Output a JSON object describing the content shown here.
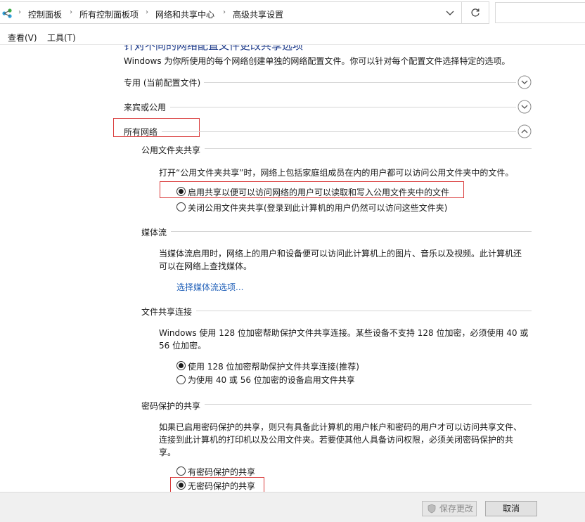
{
  "address_bar": {
    "crumbs": [
      "控制面板",
      "所有控制面板项",
      "网络和共享中心",
      "高级共享设置"
    ],
    "search_placeholder": ""
  },
  "menu": {
    "view": "查看(V)",
    "tools": "工具(T)"
  },
  "intro_partial": "针对不同的网络配置文件更改共享选项",
  "intro": "Windows 为你所使用的每个网络创建单独的网络配置文件。你可以针对每个配置文件选择特定的选项。",
  "profiles": {
    "private": "专用 (当前配置文件)",
    "guest": "来宾或公用",
    "all": "所有网络"
  },
  "public_folder": {
    "heading": "公用文件夹共享",
    "desc": "打开“公用文件夹共享”时，网络上包括家庭组成员在内的用户都可以访问公用文件夹中的文件。",
    "option_on": "启用共享以便可以访问网络的用户可以读取和写入公用文件夹中的文件",
    "option_off": "关闭公用文件夹共享(登录到此计算机的用户仍然可以访问这些文件夹)",
    "selected": "on"
  },
  "media": {
    "heading": "媒体流",
    "desc": "当媒体流启用时，网络上的用户和设备便可以访问此计算机上的图片、音乐以及视频。此计算机还可以在网络上查找媒体。",
    "link": "选择媒体流选项..."
  },
  "file_sharing": {
    "heading": "文件共享连接",
    "desc": "Windows 使用 128 位加密帮助保护文件共享连接。某些设备不支持 128 位加密，必须使用 40 或 56 位加密。",
    "option_128": "使用 128 位加密帮助保护文件共享连接(推荐)",
    "option_40_56": "为使用 40 或 56 位加密的设备启用文件共享",
    "selected": "128"
  },
  "password": {
    "heading": "密码保护的共享",
    "desc": "如果已启用密码保护的共享，则只有具备此计算机的用户帐户和密码的用户才可以访问共享文件、连接到此计算机的打印机以及公用文件夹。若要使其他人具备访问权限，必须关闭密码保护的共享。",
    "option_on": "有密码保护的共享",
    "option_off": "无密码保护的共享",
    "selected": "off"
  },
  "footer": {
    "save": "保存更改",
    "cancel": "取消"
  },
  "colors": {
    "accent_link": "#1f5fb8",
    "highlight_box": "#d93a3a"
  }
}
